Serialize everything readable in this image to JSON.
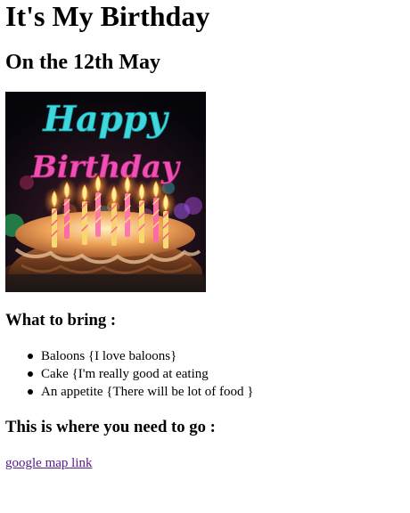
{
  "page": {
    "title": "It's My Birthday",
    "date": "On the 12th May"
  },
  "image": {
    "banner_line1": "Happy",
    "banner_line2": "Birthday",
    "alt": "Happy Birthday cake with candles",
    "title_color": "#3fd6dc",
    "subtitle_color": "#f04fb5"
  },
  "bring": {
    "heading": "What to bring :",
    "items": [
      "Baloons {I love baloons}",
      "Cake {I'm really good at eating",
      "An appetite {There will be lot of food }"
    ]
  },
  "location": {
    "heading": "This is where you need to go :",
    "link_text": "google map link",
    "link_color": "#551a8b"
  }
}
